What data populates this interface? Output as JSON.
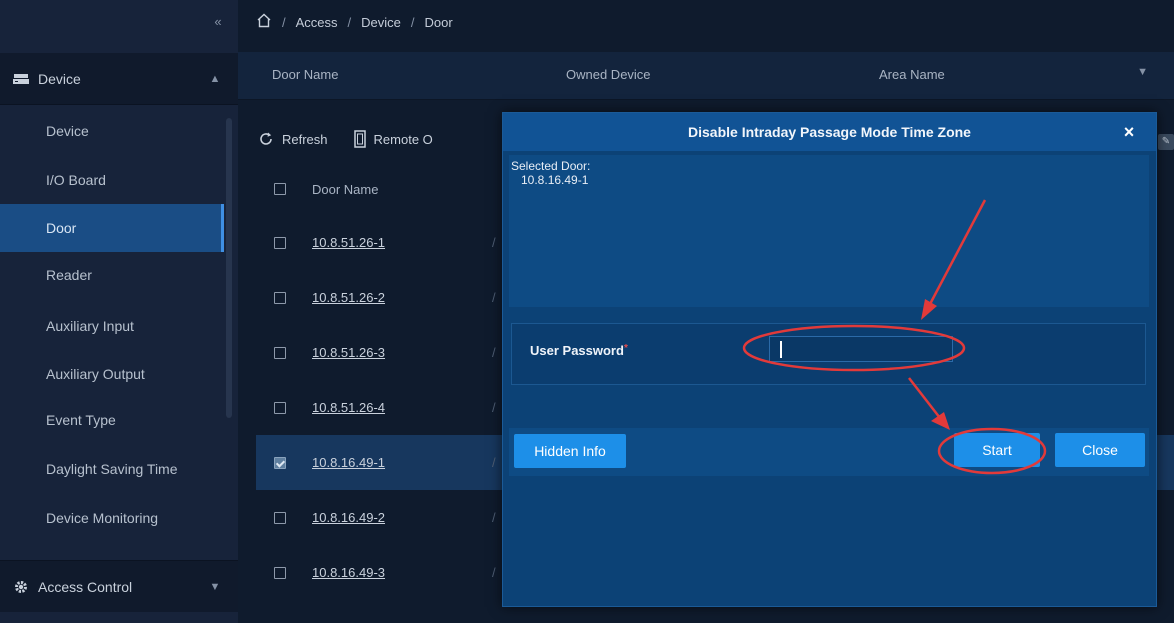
{
  "sidebar": {
    "collapse_icon": "double-chevron-left-icon",
    "device_group": {
      "label": "Device",
      "icon": "device-icon",
      "chevron": "chevron-up-icon"
    },
    "items": [
      {
        "label": "Device"
      },
      {
        "label": "I/O Board"
      },
      {
        "label": "Door"
      },
      {
        "label": "Reader"
      },
      {
        "label": "Auxiliary Input"
      },
      {
        "label": "Auxiliary Output"
      },
      {
        "label": "Event Type"
      },
      {
        "label": "Daylight Saving Time"
      },
      {
        "label": "Device Monitoring"
      }
    ],
    "active_item": "Door",
    "access_group": {
      "label": "Access Control",
      "icon": "gear-icon",
      "chevron": "chevron-down-icon"
    }
  },
  "breadcrumb": {
    "home_icon": "home-icon",
    "items": [
      "Access",
      "Device",
      "Door"
    ],
    "separator": "/"
  },
  "filter": {
    "door_name_label": "Door Name",
    "owned_device_label": "Owned Device",
    "area_name_label": "Area Name"
  },
  "toolbar": {
    "refresh_label": "Refresh",
    "remote_label": "Remote O"
  },
  "table": {
    "header": {
      "door_name": "Door Name"
    },
    "rows": [
      {
        "name": "10.8.51.26-1",
        "checked": false
      },
      {
        "name": "10.8.51.26-2",
        "checked": false
      },
      {
        "name": "10.8.51.26-3",
        "checked": false
      },
      {
        "name": "10.8.51.26-4",
        "checked": false
      },
      {
        "name": "10.8.16.49-1",
        "checked": true
      },
      {
        "name": "10.8.16.49-2",
        "checked": false
      },
      {
        "name": "10.8.16.49-3",
        "checked": false
      }
    ]
  },
  "modal": {
    "title": "Disable Intraday Passage Mode Time Zone",
    "close_icon": "close-icon",
    "selected_door_label": "Selected Door:",
    "selected_door_value": "10.8.16.49-1",
    "password_label": "User Password",
    "password_required": "*",
    "password_value": "",
    "hidden_info_label": "Hidden Info",
    "start_label": "Start",
    "close_label": "Close"
  },
  "colors": {
    "modal_bg": "#0c4276",
    "button": "#1d8fe8",
    "sidebar_active": "#1a4d85",
    "annotation_red": "#e23a3a"
  }
}
